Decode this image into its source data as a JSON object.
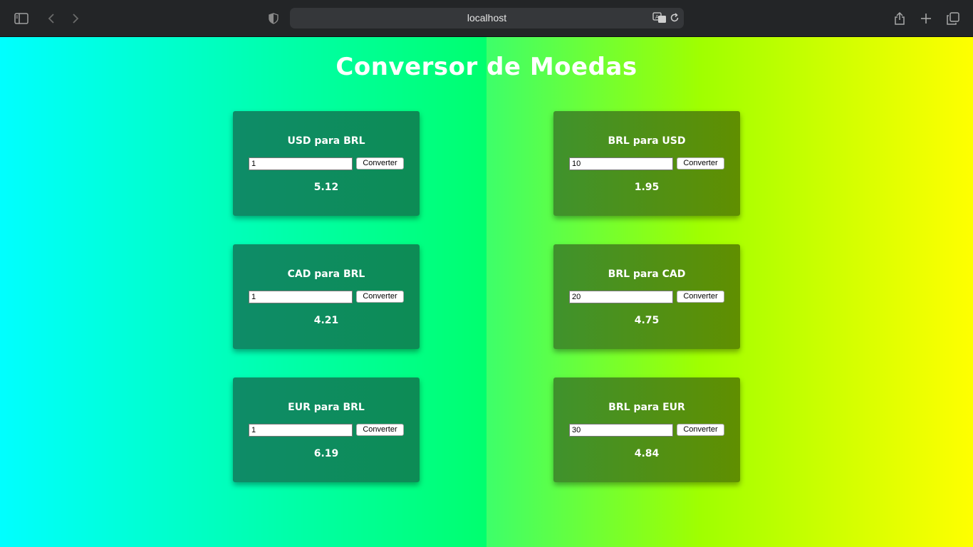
{
  "browser": {
    "url": "localhost",
    "icons": [
      "sidebar-icon",
      "back-icon",
      "forward-icon",
      "shield-icon",
      "translate-icon",
      "reload-icon",
      "share-icon",
      "new-tab-icon",
      "tabs-overview-icon"
    ]
  },
  "page": {
    "title": "Conversor de Moedas",
    "cards": [
      {
        "title": "USD para BRL",
        "value": "1",
        "button": "Converter",
        "result": "5.12"
      },
      {
        "title": "BRL para USD",
        "value": "10",
        "button": "Converter",
        "result": "1.95"
      },
      {
        "title": "CAD para BRL",
        "value": "1",
        "button": "Converter",
        "result": "4.21"
      },
      {
        "title": "BRL para CAD",
        "value": "20",
        "button": "Converter",
        "result": "4.75"
      },
      {
        "title": "EUR para BRL",
        "value": "1",
        "button": "Converter",
        "result": "6.19"
      },
      {
        "title": "BRL para EUR",
        "value": "30",
        "button": "Converter",
        "result": "4.84"
      }
    ]
  },
  "colors": {
    "gradient_start": "#00ffff",
    "gradient_mid": "#00ff6e",
    "gradient_end": "#ffff00",
    "card_left": "#0e8c68",
    "card_right": "#608f00",
    "chrome": "#232527"
  }
}
